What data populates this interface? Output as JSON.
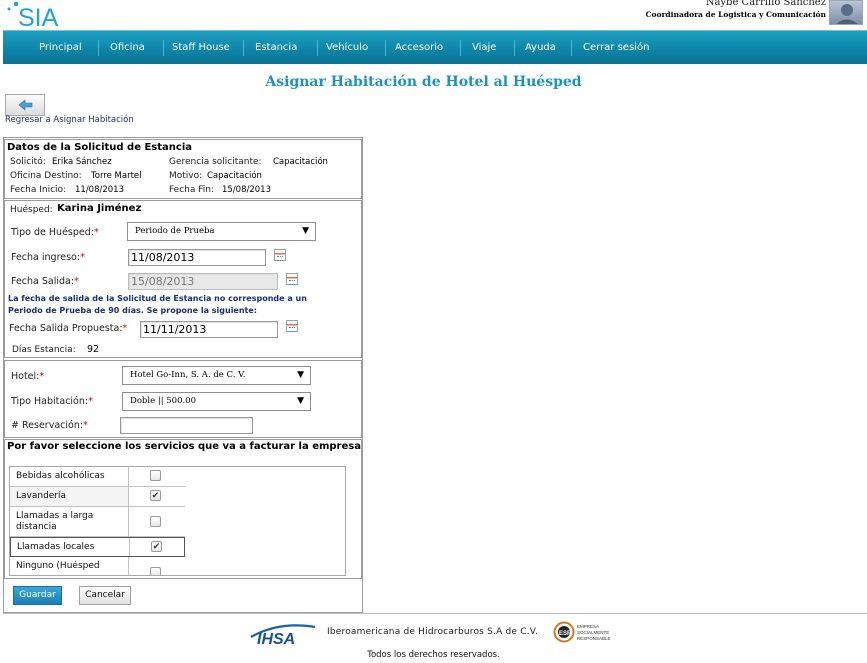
{
  "header": {
    "logo_text": "SIA",
    "user_name": "Naybe Carrillo Sanchez",
    "user_role": "Coordinadora de Logistica y Comunicación"
  },
  "nav": {
    "items": [
      "Principal",
      "Oficina",
      "Staff House",
      "Estancia",
      "Vehículo",
      "Accesorio",
      "Viaje",
      "Ayuda",
      "Cerrar sesión"
    ]
  },
  "page": {
    "title": "Asignar Habitación de Hotel al Huésped",
    "back_icon": "arrow-left-icon",
    "back_link": "Regresar a Asignar Habitación"
  },
  "solicitud": {
    "heading": "Datos de la Solicitud de Estancia",
    "solicito_label": "Solicitó:",
    "solicito_value": "Erika Sánchez",
    "gerencia_label": "Gerencia solicitante:",
    "gerencia_value": "Capacitación",
    "oficina_label": "Oficina Destino:",
    "oficina_value": "Torre Martel",
    "motivo_label": "Motivo:",
    "motivo_value": "Capacitación",
    "inicio_label": "Fecha Inicio:",
    "inicio_value": "11/08/2013",
    "fin_label": "Fecha Fin:",
    "fin_value": "15/08/2013"
  },
  "huesped": {
    "label": "Huésped:",
    "name": "Karina Jiménez",
    "tipo_label": "Tipo de Huésped:",
    "tipo_value": "Periodo de Prueba",
    "ingreso_label": "Fecha ingreso:",
    "ingreso_value": "11/08/2013",
    "salida_label": "Fecha Salida:",
    "salida_value": "15/08/2013",
    "warning_line1": "La fecha de salida de la Solicitud de Estancia no corresponde a un",
    "warning_line2": "Periodo de Prueba de 90 días. Se propone la siguiente:",
    "propuesta_label": "Fecha Salida Propuesta:",
    "propuesta_value": "11/11/2013",
    "dias_label": "Días Estancia:",
    "dias_value": "92",
    "required_mark": "*"
  },
  "hotel": {
    "hotel_label": "Hotel:",
    "hotel_value": "Hotel Go-Inn, S. A. de C. V.",
    "tipo_label": "Tipo Habitación:",
    "tipo_value": "Doble || 500.00",
    "reservacion_label": "# Reservación:",
    "reservacion_value": ""
  },
  "servicios": {
    "heading": "Por favor seleccione los servicios que va a facturar la empresa",
    "items": [
      {
        "name": "Bebidas alcohólicas",
        "checked": false
      },
      {
        "name": "Lavandería",
        "checked": true
      },
      {
        "name": "Llamadas a larga distancia",
        "checked": false
      },
      {
        "name": "Llamadas locales",
        "checked": true
      },
      {
        "name": "Ninguno (Huésped",
        "checked": false
      }
    ]
  },
  "actions": {
    "save": "Guardar",
    "cancel": "Cancelar"
  },
  "footer": {
    "logo_text": "IHSA",
    "company": "Iberoamericana de Hidrocarburos S.A de C.V.",
    "esr_text": "ESR",
    "esr_line1": "EMPRESA",
    "esr_line2": "SOCIALMENTE",
    "esr_line3": "RESPONSABLE",
    "rights": "Todos los derechos reservados."
  },
  "colors": {
    "nav": "#0d86a9",
    "title": "#1a93c3",
    "required": "#d40000",
    "warning": "#1b2a86"
  }
}
